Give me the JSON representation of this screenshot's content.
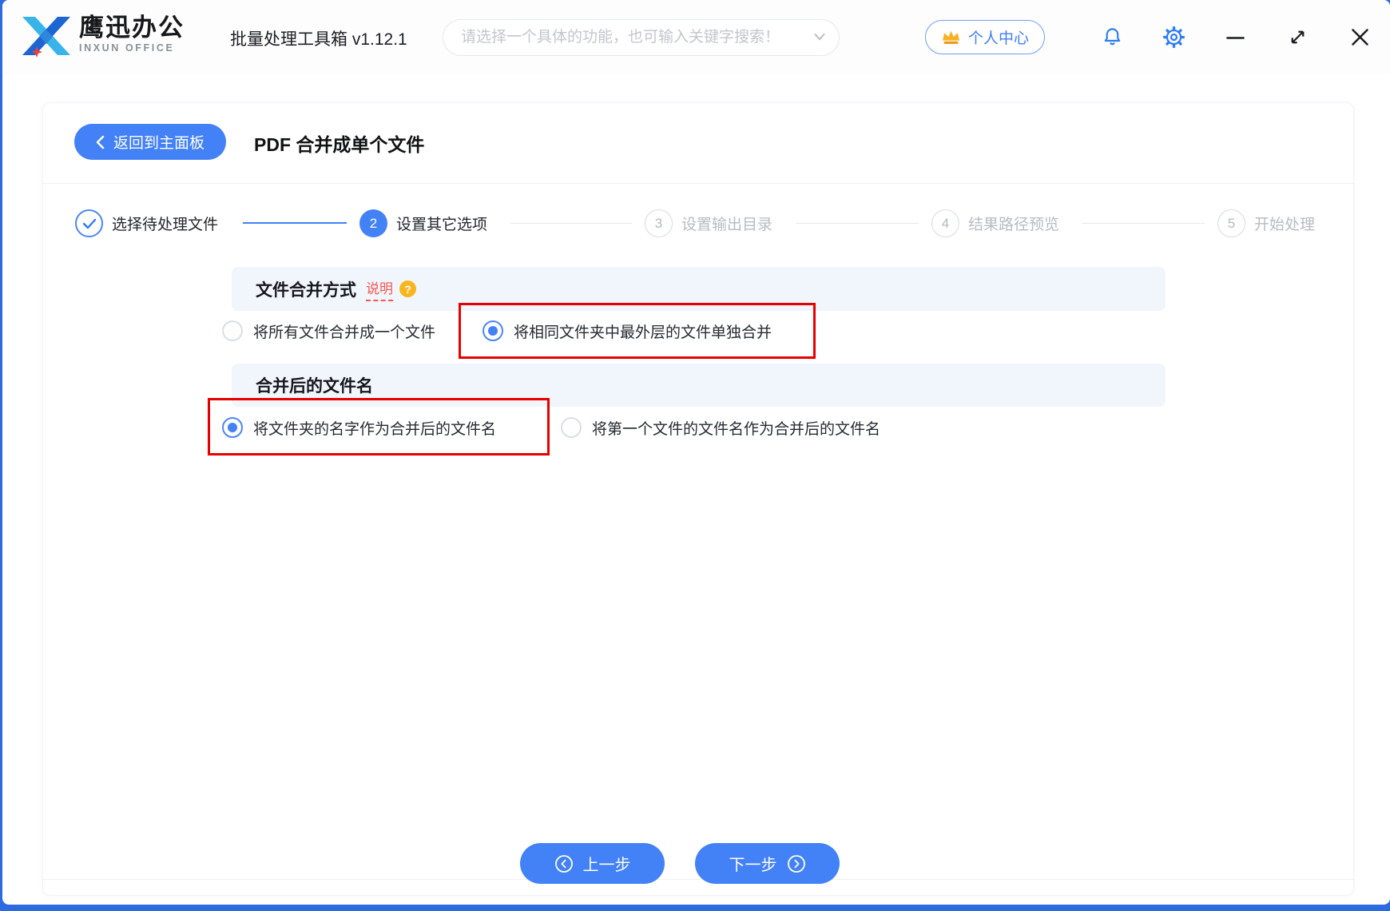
{
  "header": {
    "brand_cn": "鹰迅办公",
    "brand_en": "INXUN OFFICE",
    "app_title": "批量处理工具箱 v1.12.1",
    "search": {
      "placeholder": "请选择一个具体的功能，也可输入关键字搜索！"
    },
    "user_center": "个人中心"
  },
  "toolbar": {
    "back": "返回到主面板",
    "page_title": "PDF 合并成单个文件"
  },
  "steps": [
    {
      "num": "1",
      "label": "选择待处理文件",
      "state": "done"
    },
    {
      "num": "2",
      "label": "设置其它选项",
      "state": "active"
    },
    {
      "num": "3",
      "label": "设置输出目录",
      "state": "pending"
    },
    {
      "num": "4",
      "label": "结果路径预览",
      "state": "pending"
    },
    {
      "num": "5",
      "label": "开始处理",
      "state": "pending"
    }
  ],
  "sections": [
    {
      "title": "文件合并方式",
      "help": "说明",
      "help_mark": "?",
      "options": [
        {
          "label": "将所有文件合并成一个文件",
          "selected": false
        },
        {
          "label": "将相同文件夹中最外层的文件单独合并",
          "selected": true,
          "highlighted": true
        }
      ]
    },
    {
      "title": "合并后的文件名",
      "options": [
        {
          "label": "将文件夹的名字作为合并后的文件名",
          "selected": true,
          "highlighted": true
        },
        {
          "label": "将第一个文件的文件名作为合并后的文件名",
          "selected": false
        }
      ]
    }
  ],
  "footer": {
    "prev": "上一步",
    "next": "下一步"
  },
  "colors": {
    "primary": "#4381f6",
    "highlight_red": "#e60000",
    "accent_orange": "#f8b51e",
    "danger_text": "#f5564e",
    "section_bar_bg": "#f1f5fc",
    "step_inactive": "#b7bbc2",
    "dark_text": "#23262d"
  }
}
